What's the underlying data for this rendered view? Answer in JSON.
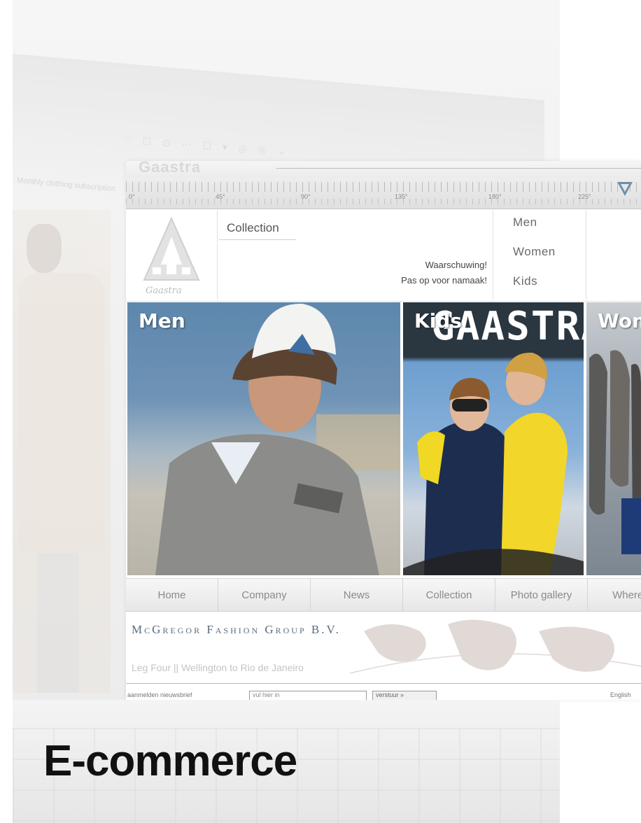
{
  "background": {
    "faded_text": "Monthly clothing subscription"
  },
  "site": {
    "brand": "Gaastra",
    "ruler_labels": [
      "0°",
      "45°",
      "90°",
      "135°",
      "180°",
      "225°"
    ],
    "collection_title": "Collection",
    "warning_line1": "Waarschuwing!",
    "warning_line2": "Pas op voor namaak!",
    "categories": [
      "Men",
      "Women",
      "Kids"
    ],
    "photos": [
      {
        "label": "Men"
      },
      {
        "label": "Kids",
        "banner": "GAASTRA"
      },
      {
        "label": "Women"
      }
    ],
    "nav": [
      "Home",
      "Company",
      "News",
      "Collection",
      "Photo gallery",
      "Where to"
    ],
    "group_name": "McGregor Fashion Group B.V.",
    "leg_text": "Leg Four || Wellington to Rio de Janeiro",
    "footer": {
      "newsletter_label": "aanmelden nieuwsbrief",
      "input_placeholder": "vul hier in",
      "submit_label": "verstuur »",
      "language": "English"
    }
  },
  "heading": "E-commerce",
  "colors": {
    "ruler_indicator": "#6f8fa6",
    "group_name": "#5a6c80"
  }
}
